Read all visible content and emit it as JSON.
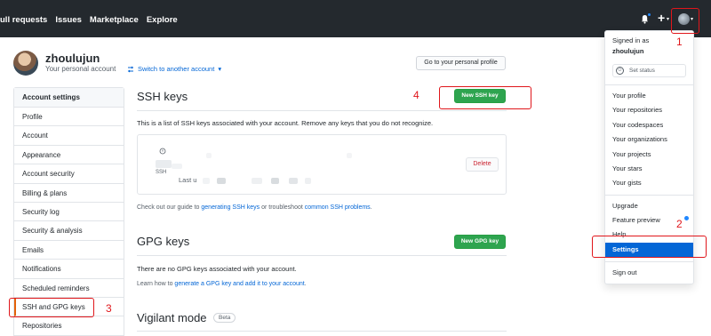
{
  "nav": {
    "links": [
      "ull requests",
      "Issues",
      "Marketplace",
      "Explore"
    ],
    "plus_label": "+",
    "caret": "▾"
  },
  "user": {
    "name": "zhoulujun",
    "subtitle": "Your personal account",
    "switch_label": "Switch to another account",
    "goto_label": "Go to your personal profile"
  },
  "sidebar": {
    "heading": "Account settings",
    "items": [
      {
        "label": "Profile"
      },
      {
        "label": "Account"
      },
      {
        "label": "Appearance"
      },
      {
        "label": "Account security"
      },
      {
        "label": "Billing & plans"
      },
      {
        "label": "Security log"
      },
      {
        "label": "Security & analysis"
      },
      {
        "label": "Emails"
      },
      {
        "label": "Notifications"
      },
      {
        "label": "Scheduled reminders"
      },
      {
        "label": "SSH and GPG keys"
      },
      {
        "label": "Repositories"
      }
    ]
  },
  "ssh": {
    "heading": "SSH keys",
    "new_button": "New SSH key",
    "description": "This is a list of SSH keys associated with your account. Remove any keys that you do not recognize.",
    "key_label": "SSH",
    "last_prefix": "Last u",
    "delete_label": "Delete",
    "guide_prefix": "Check out our guide to ",
    "guide_link1": "generating SSH keys",
    "guide_mid": " or troubleshoot ",
    "guide_link2": "common SSH problems",
    "guide_suffix": "."
  },
  "gpg": {
    "heading": "GPG keys",
    "new_button": "New GPG key",
    "none_text": "There are no GPG keys associated with your account.",
    "learn_prefix": "Learn how to ",
    "learn_link": "generate a GPG key and add it to your account",
    "learn_suffix": "."
  },
  "vigilant": {
    "heading": "Vigilant mode",
    "badge": "Beta"
  },
  "dropdown": {
    "signed_in_as": "Signed in as",
    "username": "zhoulujun",
    "set_status": "Set status",
    "group1": [
      "Your profile",
      "Your repositories",
      "Your codespaces",
      "Your organizations",
      "Your projects",
      "Your stars",
      "Your gists"
    ],
    "group2": [
      "Upgrade",
      "Feature preview",
      "Help"
    ],
    "settings": "Settings",
    "sign_out": "Sign out"
  },
  "annotations": [
    "1",
    "2",
    "3",
    "4"
  ],
  "colors": {
    "topbar": "#24292e",
    "primary_button": "#2ea44f",
    "link": "#0366d6",
    "annotation": "#e0161b"
  }
}
